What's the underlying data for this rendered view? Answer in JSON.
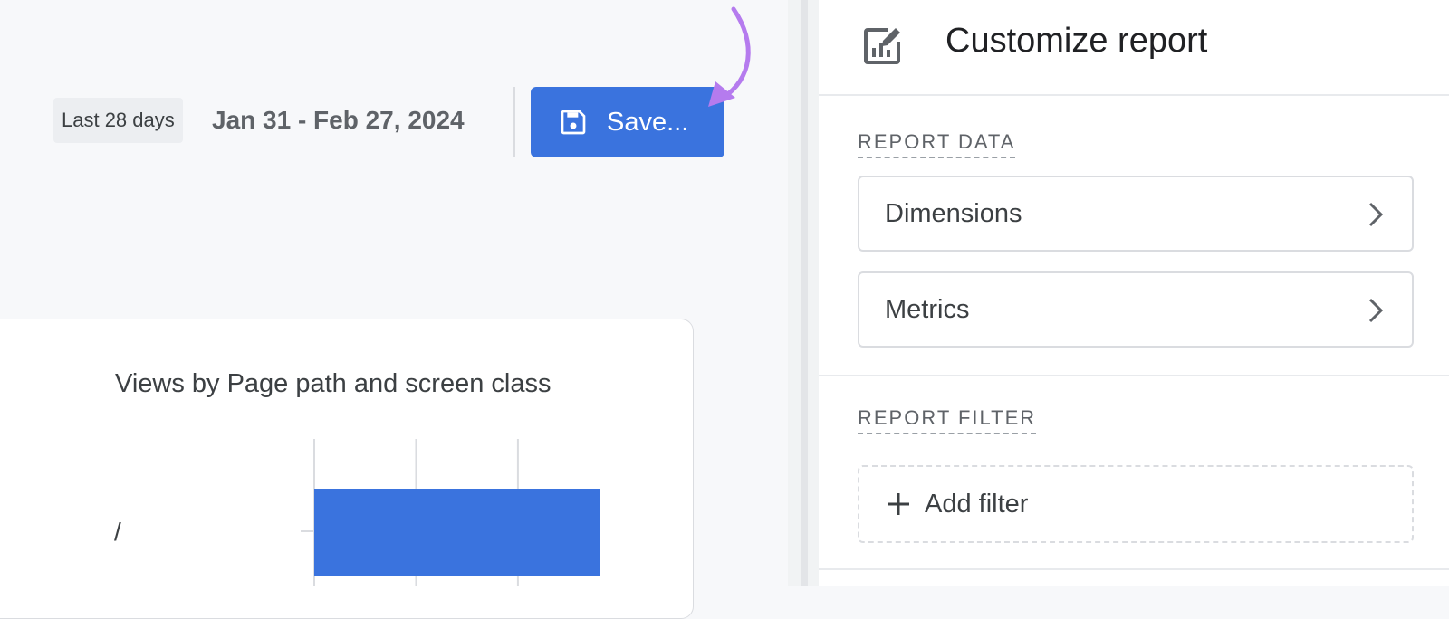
{
  "toolbar": {
    "range_label": "Last 28 days",
    "date_range": "Jan 31 - Feb 27, 2024",
    "save_label": "Save..."
  },
  "report_card": {
    "chart_title": "Views by Page path and screen class"
  },
  "chart_data": {
    "type": "bar",
    "orientation": "horizontal",
    "categories": [
      "/"
    ],
    "values": [
      1
    ],
    "xlim": [
      0,
      1.6
    ],
    "grid": true,
    "title": "Views by Page path and screen class"
  },
  "customize_panel": {
    "title": "Customize report",
    "report_data_label": "REPORT DATA",
    "items": [
      {
        "label": "Dimensions"
      },
      {
        "label": "Metrics"
      }
    ],
    "report_filter_label": "REPORT FILTER",
    "add_filter_label": "Add filter"
  },
  "colors": {
    "accent": "#3a73de",
    "annotation_arrow": "#b57bee"
  },
  "icons": {
    "save": "floppy-disk-icon",
    "customize": "edit-chart-icon",
    "chevron": "chevron-right-icon",
    "add": "plus-icon"
  }
}
